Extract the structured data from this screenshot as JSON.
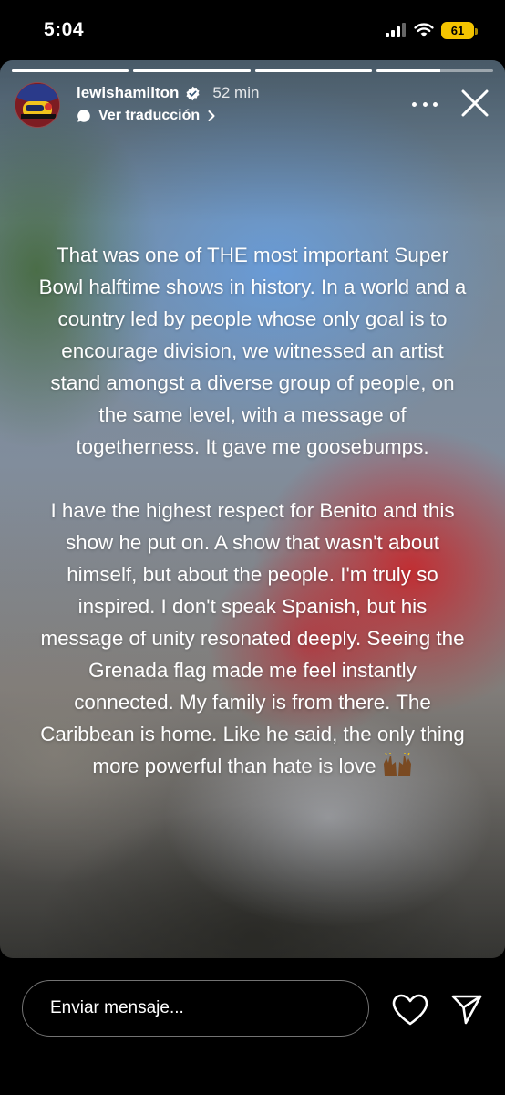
{
  "status_bar": {
    "time": "5:04",
    "battery": "61"
  },
  "story": {
    "progress": [
      1,
      1,
      1,
      0.55
    ],
    "username": "lewishamilton",
    "time_ago": "52 min",
    "translate_label": "Ver traducción",
    "caption_paragraphs": [
      "That was one of THE most important Super Bowl halftime shows in history. In a world and a country led by people whose only goal is to encourage division, we witnessed an artist stand amongst a diverse group of people, on the same level, with a message of togetherness. It gave me goosebumps.",
      "I have the highest respect for Benito and this show he put on. A show that wasn't about himself, but about the people. I'm truly so inspired. I don't speak Spanish, but his message of unity resonated deeply. Seeing the Grenada flag made me feel instantly connected. My family is from there. The Caribbean is home. Like he said, the only thing more powerful than hate is love"
    ]
  },
  "reply": {
    "placeholder": "Enviar mensaje..."
  },
  "icons": {
    "verified": "verified-badge-icon",
    "translate": "speech-bubble-icon",
    "chevron": "chevron-right-icon",
    "more": "more-horizontal-icon",
    "close": "close-icon",
    "like": "heart-icon",
    "share": "send-icon",
    "emoji": "raising-hands-emoji"
  },
  "colors": {
    "battery": "#f4c400",
    "background": "#000000",
    "text": "#ffffff"
  }
}
